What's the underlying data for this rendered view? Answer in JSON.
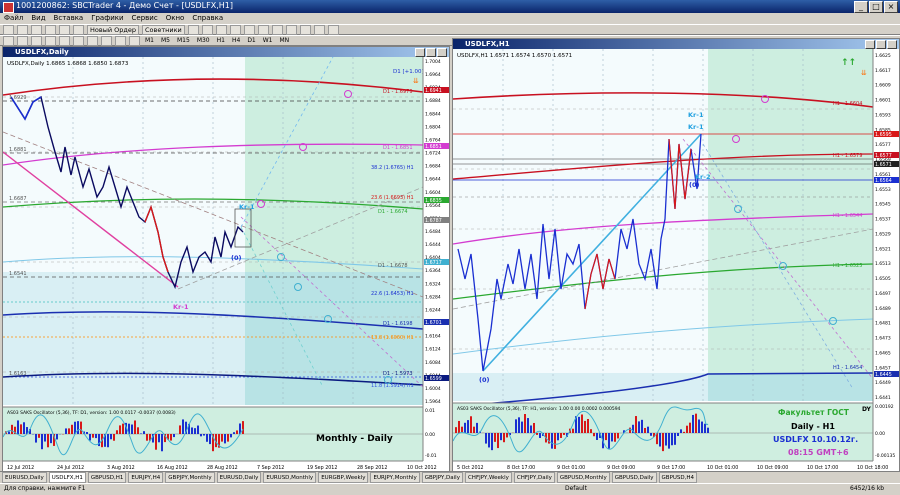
{
  "app": {
    "title": "1001200862: SBCTrader 4 - Демо Счет - [USDLFX,H1]"
  },
  "menu": [
    "Файл",
    "Вид",
    "Вставка",
    "Графики",
    "Сервис",
    "Окно",
    "Справка"
  ],
  "toolbar": {
    "new_order": "Новый Ордер",
    "advisors": "Советники",
    "timeframes": [
      "M1",
      "M5",
      "M15",
      "M30",
      "H1",
      "H4",
      "D1",
      "W1",
      "MN"
    ]
  },
  "left": {
    "title": "USDLFX,Daily",
    "info": "USDLFX,Daily  1.6865 1.6868 1.6850 1.6873",
    "dates": [
      "12 Jul 2012",
      "24 Jul 2012",
      "3 Aug 2012",
      "16 Aug 2012",
      "28 Aug 2012",
      "7 Sep 2012",
      "19 Sep 2012",
      "28 Sep 2012",
      "10 Oct 2012"
    ],
    "yticks": [
      "1.7004",
      "1.6964",
      "1.6924",
      "1.6884",
      "1.6844",
      "1.6804",
      "1.6764",
      "1.6724",
      "1.6684",
      "1.6644",
      "1.6604",
      "1.6564",
      "1.6524",
      "1.6484",
      "1.6444",
      "1.6404",
      "1.6364",
      "1.6324",
      "1.6284",
      "1.6244",
      "1.6204",
      "1.6164",
      "1.6124",
      "1.6084",
      "1.6044",
      "1.6004",
      "1.5964"
    ],
    "price_labels": [
      "1.6941",
      "1.6851",
      "1.6835",
      "1.6787",
      "1.6717",
      "1.6701",
      "1.6599",
      "1.6559",
      "1.6465"
    ],
    "osc_ticks": [
      "0.01",
      "0.00",
      "-0.01"
    ],
    "level_labels": [
      "1.6929",
      "1.6881",
      "1.6687",
      "1.6541",
      "1.6163"
    ],
    "line_labels": [
      "D1 - 1.6979",
      "D1 - 1.6851",
      "38.2 (1.6765) H1",
      "23.6 (1.6693) H1",
      "D1 - 1.6674",
      "D1 - 1.6678",
      "22.6 (1.6453) H1",
      "D1 - 1.6198",
      "13.8 (1.6060) H1",
      "D1 - 1.5973",
      "11.8 (1.5914) H1"
    ],
    "mark_kr1": "Kr-1",
    "mark_kr1b": "Kr-1",
    "mark_0": "(0)",
    "osc_label": "AS03 SAKS Oscillator (5,36), TF: D1, version: 1.00  0.0117 -0.0037 (0.0083)",
    "overlay": "Monthly - Daily",
    "top_right": "D1 [+1.00]"
  },
  "right": {
    "title": "USDLFX,H1",
    "info": "USDLFX,H1  1.6571 1.6574 1.6570 1.6571",
    "dates": [
      "5 Oct 2012",
      "8 Oct 17:00",
      "9 Oct 01:00",
      "9 Oct 09:00",
      "9 Oct 17:00",
      "10 Oct 01:00",
      "10 Oct 09:00",
      "10 Oct 17:00",
      "10 Oct 18:00"
    ],
    "yticks": [
      "1.6625",
      "1.6617",
      "1.6609",
      "1.6601",
      "1.6593",
      "1.6585",
      "1.6577",
      "1.6569",
      "1.6561",
      "1.6553",
      "1.6545",
      "1.6537",
      "1.6529",
      "1.6521",
      "1.6513",
      "1.6505",
      "1.6497",
      "1.6489",
      "1.6481",
      "1.6473",
      "1.6465",
      "1.6457",
      "1.6449",
      "1.6441"
    ],
    "price_labels": [
      "1.6595",
      "1.6577",
      "1.6571",
      "1.6564",
      "1.6445"
    ],
    "osc_ticks": [
      "0.00192",
      "0.00",
      "-0.00135"
    ],
    "line_labels": [
      "H1 - 1.6604",
      "H1 - 1.6579",
      "H1 - 1.6544",
      "H1 - 1.6525",
      "H1 - 1.6454"
    ],
    "mark_kr1": "Kr-1",
    "mark_kr1b": "Kr-1",
    "mark_kr2": "Kr-2",
    "mark_0a": "(0)",
    "mark_0b": "(0)",
    "osc_label": "AS03 SAKS Oscillator (5,36), TF: H1, version: 1.00  0.00 0.0002 0.000594",
    "overlay": {
      "line1": "Факультет ГОСТ",
      "line2": "Daily - H1",
      "line3": "USDLFX 10.10.12г.",
      "line4": "08:15  GMT+6"
    },
    "dy": "DY"
  },
  "tabs": [
    "EURUSD,Daily",
    "USDLFX,H1",
    "GBPUSD,H1",
    "EURJPY,H4",
    "GBPJPY,Monthly",
    "EURUSD,Daily",
    "EURUSD,Monthly",
    "EURGBP,Weekly",
    "EURJPY,Monthly",
    "GBPJPY,Daily",
    "CHFJPY,Weekly",
    "CHFJPY,Daily",
    "GBPUSD,Monthly",
    "GBPUSD,Daily",
    "GBPUSD,H4"
  ],
  "active_tab": 1,
  "status": {
    "help": "Для справки, нажмите F1",
    "profile": "Default",
    "traffic": "6452/16 kb"
  },
  "colors": {
    "bg": "#ffffff",
    "future": "#cdeee0",
    "osc_bg": "#cfeee0",
    "up": "#1a2fd1",
    "down": "#d81818",
    "teal": "#40b0d0"
  }
}
